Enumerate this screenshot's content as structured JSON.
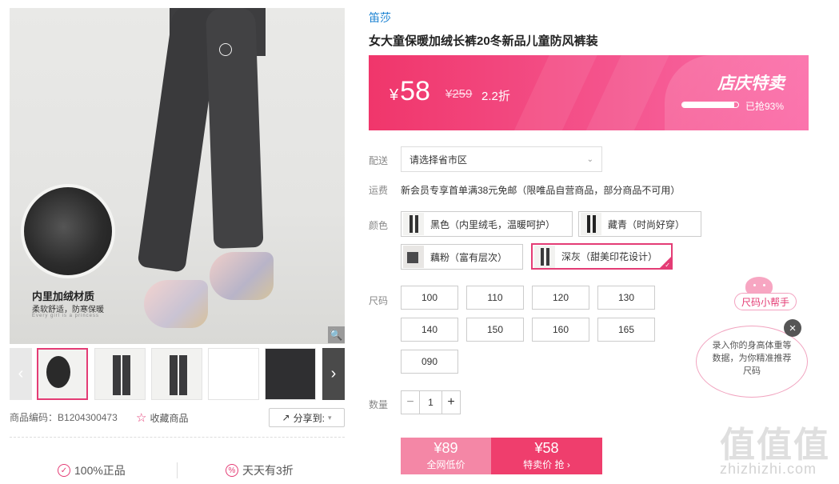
{
  "gallery": {
    "caption_title": "内里加绒材质",
    "caption_sub": "柔软舒适，防寒保暖",
    "caption_en": "Every girl is a princess",
    "zoom_icon": "magnifier-icon",
    "prev_label": "‹",
    "next_label": "›"
  },
  "product_meta": {
    "code_label": "商品编码：",
    "code_value": "B1204300473",
    "favorite_label": "收藏商品",
    "share_label": "分享到:"
  },
  "guarantees": [
    {
      "label": "100%正品",
      "icon": "✓"
    },
    {
      "label": "天天有3折",
      "icon": "%"
    }
  ],
  "product": {
    "brand": "笛莎",
    "title": "女大童保暖加绒长裤20冬新品儿童防风裤装"
  },
  "price_banner": {
    "currency": "¥",
    "price": "58",
    "original": "¥259",
    "discount": "2.2折",
    "promo_tag": "店庆特卖",
    "sold_text": "已抢93%",
    "sold_percent": 93,
    "gradient_start": "#f0366b",
    "gradient_end": "#fb6ca8"
  },
  "shipping": {
    "label": "配送",
    "select_value": "请选择省市区",
    "fee_label": "运费",
    "fee_text": "新会员专享首单满38元免邮（限唯品自营商品，部分商品不可用）"
  },
  "colors": {
    "label": "颜色",
    "options": [
      {
        "label": "黑色（内里绒毛，温暖呵护）",
        "selected": false
      },
      {
        "label": "藏青（时尚好穿）",
        "selected": false
      },
      {
        "label": "藕粉（富有层次）",
        "selected": false
      },
      {
        "label": "深灰（甜美印花设计）",
        "selected": true
      }
    ]
  },
  "sizes": {
    "label": "尺码",
    "options": [
      "100",
      "110",
      "120",
      "130",
      "140",
      "150",
      "160",
      "165",
      "090"
    ]
  },
  "quantity": {
    "label": "数量",
    "minus": "−",
    "value": "1",
    "plus": "+"
  },
  "buy": {
    "left_price": "¥89",
    "left_sub": "全网低价",
    "right_price": "¥58",
    "right_sub": "特卖价 抢 ›"
  },
  "size_helper": {
    "title": "尺码小帮手",
    "bubble_text": "录入你的身高体重等数据，为你精准推荐尺码",
    "close": "×"
  },
  "watermark": {
    "logo": "值值值",
    "domain": "zhizhizhi.com"
  },
  "accent_color": "#e43c75"
}
